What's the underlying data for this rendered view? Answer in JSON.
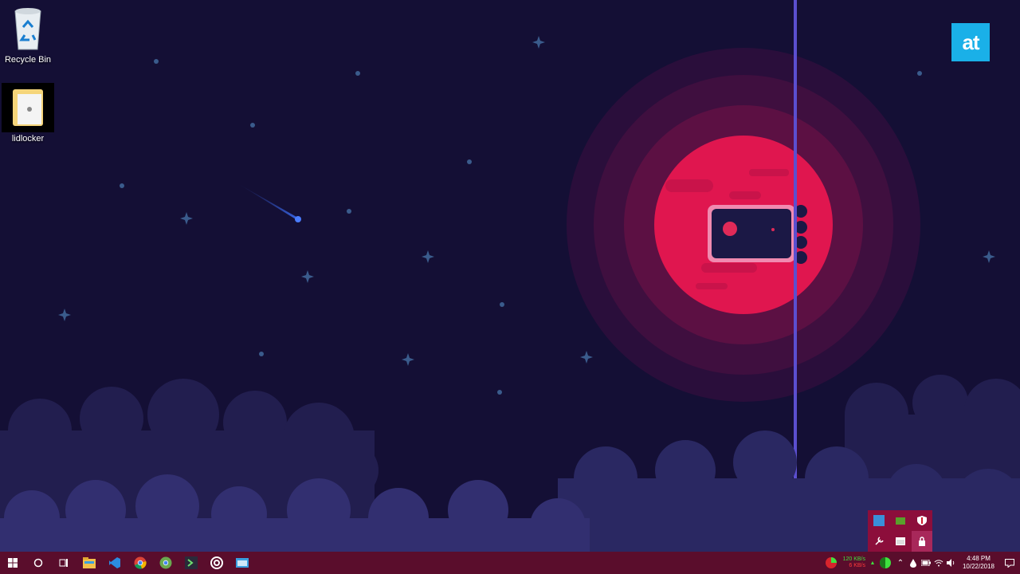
{
  "desktop": {
    "icons": [
      {
        "label": "Recycle Bin",
        "icon": "recycle-bin-icon"
      },
      {
        "label": "lidlocker",
        "icon": "folder-icon"
      }
    ],
    "brand_logo": "at",
    "accent_color": "#1ab0e8"
  },
  "taskbar": {
    "color": "#5a0d2c",
    "start_icon": "windows-start-icon",
    "search_icon": "cortana-circle-icon",
    "task_view_icon": "task-view-icon",
    "pinned_apps": [
      {
        "name": "file-explorer-icon"
      },
      {
        "name": "vs-code-icon"
      },
      {
        "name": "chrome-icon"
      },
      {
        "name": "chrome-canary-icon"
      },
      {
        "name": "terminal-app-icon"
      },
      {
        "name": "target-app-icon"
      },
      {
        "name": "window-app-icon"
      }
    ],
    "tray": {
      "net_up": "120 KB/s",
      "net_down": "6 KB/s",
      "time": "4:48 PM",
      "date": "10/22/2018"
    }
  },
  "tray_flyout": {
    "icons": [
      "windows-defender-icon",
      "nvidia-icon",
      "shield-icon",
      "tool-icon",
      "window-icon",
      "lock-icon"
    ],
    "selected": "lock-icon"
  }
}
